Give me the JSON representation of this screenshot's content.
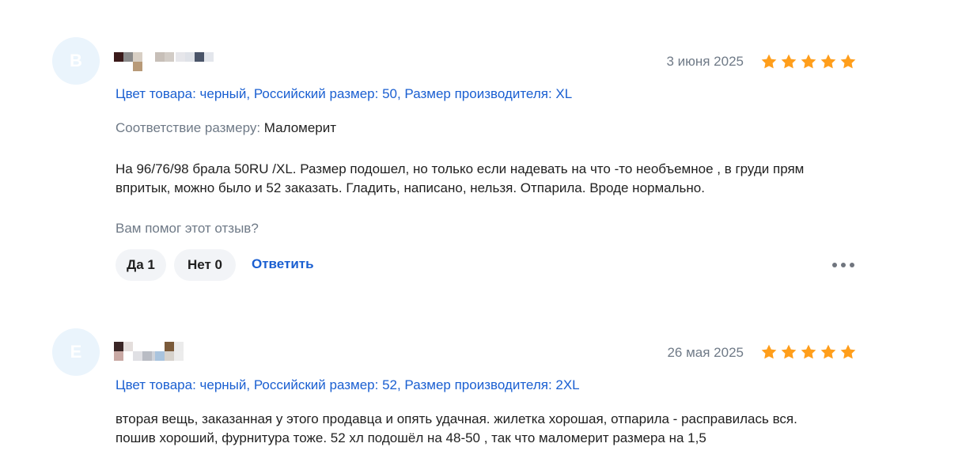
{
  "reviews": [
    {
      "avatar_letter": "В",
      "date": "3 июня 2025",
      "rating": 5,
      "variant": "Цвет товара: черный, Российский размер: 50, Размер производителя: XL",
      "fit_label": "Соответствие размеру:",
      "fit_value": "Маломерит",
      "text_lines": [
        "На 96/76/98 брала 50RU /XL. Размер подошел, но только если надевать на что -то необъемное , в груди прям",
        "впритык, можно было и 52 заказать. Гладить, написано, нельзя. Отпарила. Вроде нормально."
      ],
      "helpful_question": "Вам помог этот отзыв?",
      "yes_label": "Да 1",
      "no_label": "Нет 0",
      "reply_label": "Ответить"
    },
    {
      "avatar_letter": "Е",
      "date": "26 мая 2025",
      "rating": 5,
      "variant": "Цвет товара: черный, Российский размер: 52, Размер производителя: 2XL",
      "text_lines": [
        "вторая вещь, заказанная у этого продавца и опять удачная. жилетка хорошая, отпарила - расправилась вся.",
        "пошив хороший, фурнитура тоже. 52 хл подошёл на 48-50 , так что маломерит размера на 1,5"
      ]
    }
  ],
  "colors": {
    "accent_link": "#1a5fd1",
    "star": "#ff9e1b",
    "muted_text": "#6f7a87",
    "avatar_bg": "#eaf4fc",
    "button_bg": "#f2f4f7"
  },
  "icons": {
    "star": "star-icon",
    "more": "more-dots-icon"
  }
}
